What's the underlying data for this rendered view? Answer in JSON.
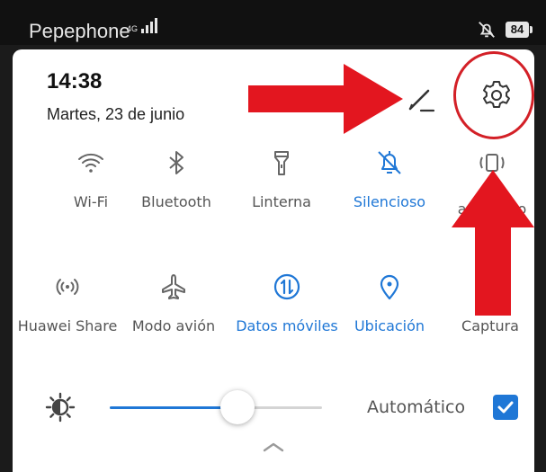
{
  "status_bar": {
    "carrier": "Pepephone",
    "network_type": "4G",
    "battery": "84",
    "icons": [
      "signal-icon",
      "do-not-disturb-icon",
      "battery-icon"
    ]
  },
  "header": {
    "time": "14:38",
    "date": "Martes, 23 de junio",
    "icons": [
      "edit-pencil-icon",
      "settings-gear-icon"
    ]
  },
  "toggles": {
    "row1": [
      {
        "label": "Wi-Fi",
        "icon": "wifi-icon",
        "active": false
      },
      {
        "label": "Bluetooth",
        "icon": "bluetooth-icon",
        "active": false
      },
      {
        "label": "Linterna",
        "icon": "flashlight-icon",
        "active": false
      },
      {
        "label": "Silencioso",
        "icon": "bell-off-icon",
        "active": true
      },
      {
        "label": "auto",
        "label_suffix": "co",
        "icon": "auto-rotate-icon",
        "active": false
      }
    ],
    "row2": [
      {
        "label": "Huawei Share",
        "icon": "huawei-share-icon",
        "active": false
      },
      {
        "label": "Modo avión",
        "icon": "airplane-icon",
        "active": false
      },
      {
        "label": "Datos móviles",
        "icon": "mobile-data-icon",
        "active": true
      },
      {
        "label": "Ubicación",
        "icon": "location-icon",
        "active": true
      },
      {
        "label": "Captura",
        "icon": "screenshot-icon",
        "active": false
      }
    ]
  },
  "brightness": {
    "level": 0.6,
    "auto_label": "Automático",
    "auto_checked": true
  },
  "colors": {
    "accent": "#1f77d6",
    "annotation_red": "#e3161f",
    "label_gray": "#555555"
  }
}
